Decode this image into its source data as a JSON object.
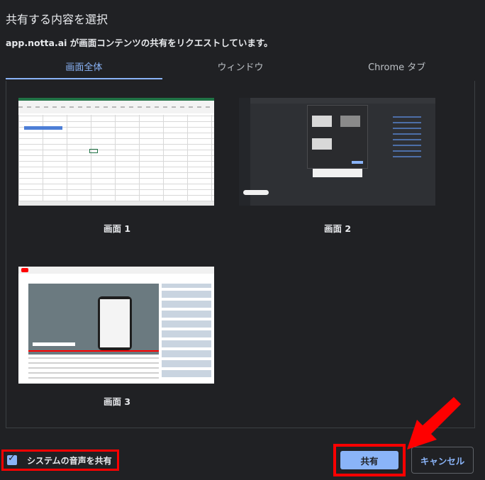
{
  "dialog": {
    "title": "共有する内容を選択",
    "subtitle": "app.notta.ai が画面コンテンツの共有をリクエストしています。"
  },
  "tabs": [
    {
      "label": "画面全体",
      "active": true
    },
    {
      "label": "ウィンドウ",
      "active": false
    },
    {
      "label": "Chrome タブ",
      "active": false
    }
  ],
  "screens": [
    {
      "label": "画面 1"
    },
    {
      "label": "画面 2"
    },
    {
      "label": "画面 3"
    }
  ],
  "footer": {
    "audio_label": "システムの音声を共有",
    "audio_checked": true,
    "share_label": "共有",
    "cancel_label": "キャンセル"
  },
  "colors": {
    "accent": "#8ab4f8",
    "highlight": "#ff0000",
    "background": "#202124"
  }
}
